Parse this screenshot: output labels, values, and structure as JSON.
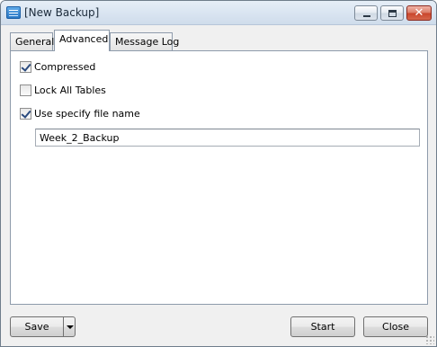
{
  "window": {
    "title": "[New Backup]",
    "app_icon": "database-icon",
    "controls": [
      "minimize-icon",
      "maximize-icon",
      "close-icon"
    ],
    "close_glyph": "✕"
  },
  "tabs": [
    {
      "label": "General",
      "active": false
    },
    {
      "label": "Advanced",
      "active": true
    },
    {
      "label": "Message Log",
      "active": false
    }
  ],
  "advanced": {
    "compressed": {
      "label": "Compressed",
      "checked": true
    },
    "lock_all_tables": {
      "label": "Lock All Tables",
      "checked": false
    },
    "use_specify_file_name": {
      "label": "Use specify file name",
      "checked": true
    },
    "file_name_value": "Week_2_Backup"
  },
  "footer": {
    "save_label": "Save",
    "start_label": "Start",
    "close_label": "Close"
  }
}
